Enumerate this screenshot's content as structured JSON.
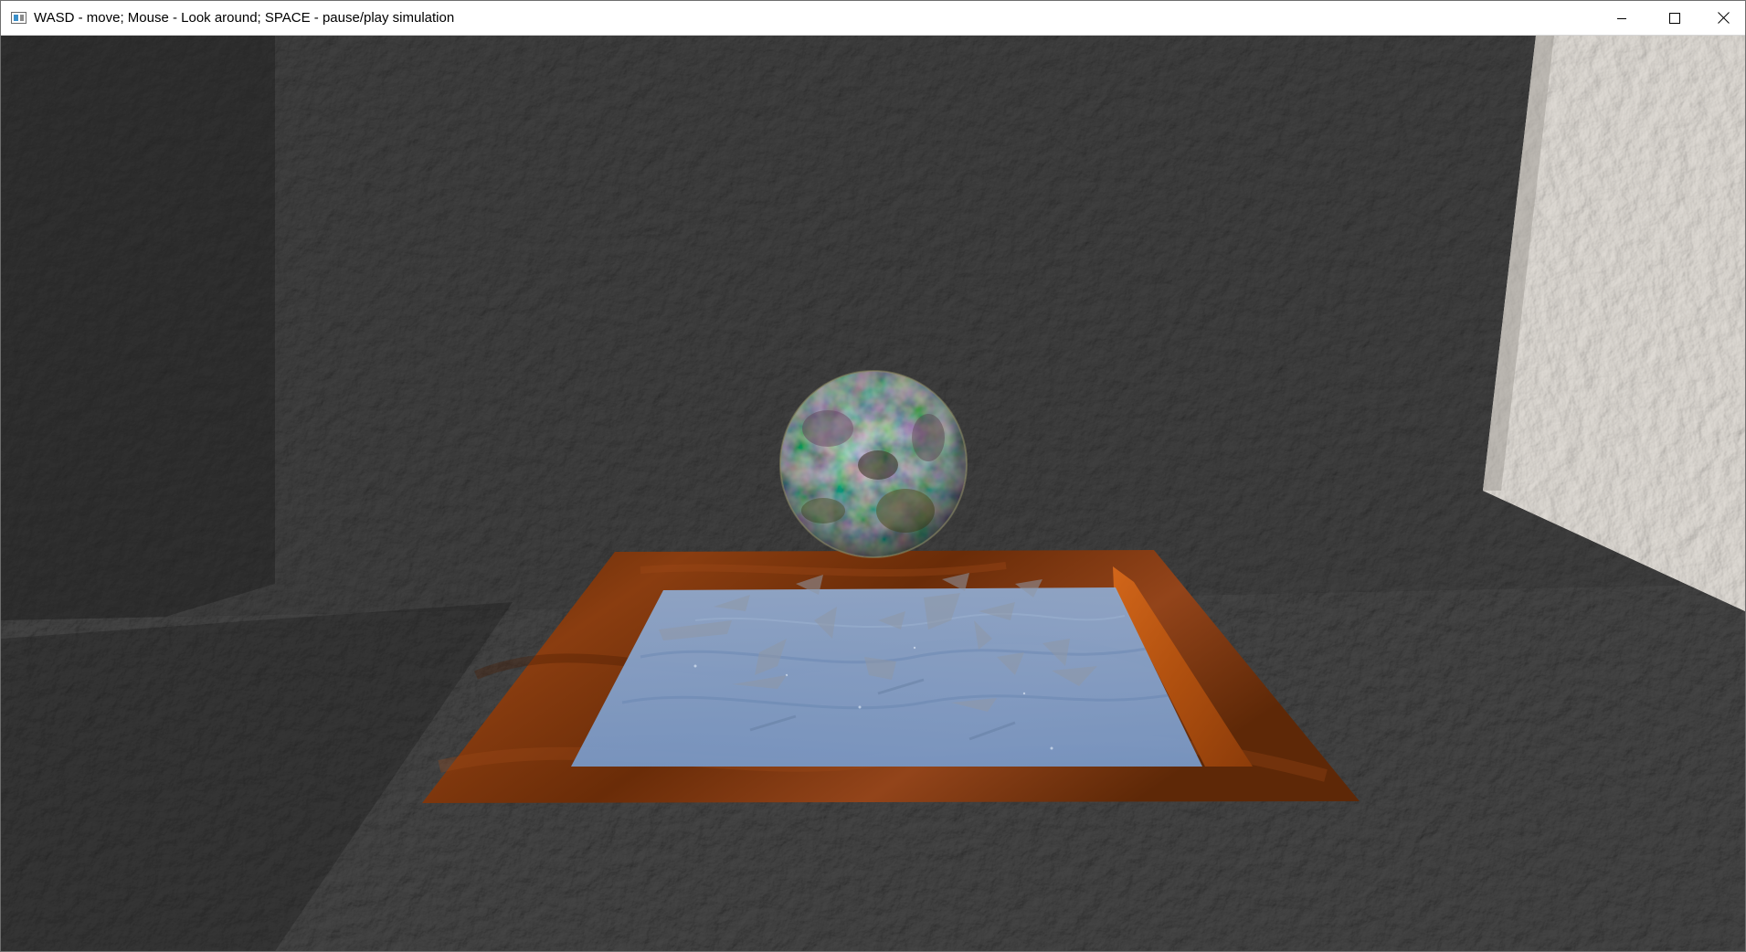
{
  "window": {
    "title": "WASD - move; Mouse - Look around; SPACE - pause/play simulation",
    "icon": "app-window-icon",
    "controls": [
      "minimize-icon",
      "maximize-icon",
      "close-icon"
    ]
  },
  "scene": {
    "objects": [
      "textured-back-wall",
      "textured-floor",
      "left-wall",
      "right-white-wall",
      "planet-sphere",
      "wooden-tray",
      "water-surface",
      "glass-shards"
    ],
    "colors": {
      "wall": "#2b2b2b",
      "floor": "#262626",
      "right_wall": "#cfcac4",
      "wood": "#8a3a0e",
      "water": "#7e9cc6",
      "sphere": "#55523a"
    }
  }
}
